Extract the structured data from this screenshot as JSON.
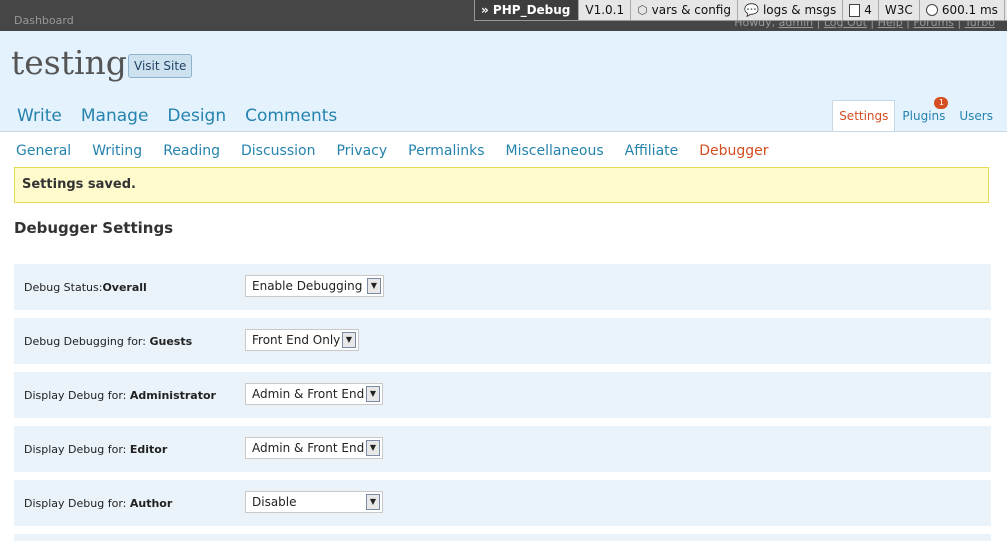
{
  "topbar": {
    "dashboard_label": "Dashboard",
    "howdy_prefix": "Howdy, ",
    "user": "admin",
    "links": [
      "Log Out",
      "Help",
      "Forums",
      "Turbo"
    ]
  },
  "php_debug": {
    "title": "» PHP_Debug",
    "version": "V1.0.1",
    "vars_label": "vars & config",
    "logs_label": "logs & msgs",
    "count": "4",
    "w3c_label": "W3C",
    "time": "600.1 ms"
  },
  "header": {
    "site_title": "testing",
    "visit_site_label": "Visit Site",
    "main_nav": [
      "Write",
      "Manage",
      "Design",
      "Comments"
    ],
    "right_nav": {
      "settings": "Settings",
      "plugins": "Plugins",
      "plugins_badge": "1",
      "users": "Users"
    }
  },
  "sub_nav": [
    "General",
    "Writing",
    "Reading",
    "Discussion",
    "Privacy",
    "Permalinks",
    "Miscellaneous",
    "Affiliate",
    "Debugger"
  ],
  "message": "Settings saved.",
  "page_title": "Debugger Settings",
  "rows": [
    {
      "label_prefix": "Debug Status:",
      "label_bold": "Overall",
      "value": "Enable Debugging"
    },
    {
      "label_prefix": "Debug Debugging for: ",
      "label_bold": "Guests",
      "value": "Front End Only"
    },
    {
      "label_prefix": "Display Debug for: ",
      "label_bold": "Administrator",
      "value": "Admin & Front End"
    },
    {
      "label_prefix": "Display Debug for: ",
      "label_bold": "Editor",
      "value": "Admin & Front End"
    },
    {
      "label_prefix": "Display Debug for: ",
      "label_bold": "Author",
      "value": "Disable"
    }
  ],
  "colors": {
    "link": "#2583ad",
    "active": "#d54e21",
    "header_bg": "#e4f2fd",
    "row_bg": "#eaf3fa"
  }
}
